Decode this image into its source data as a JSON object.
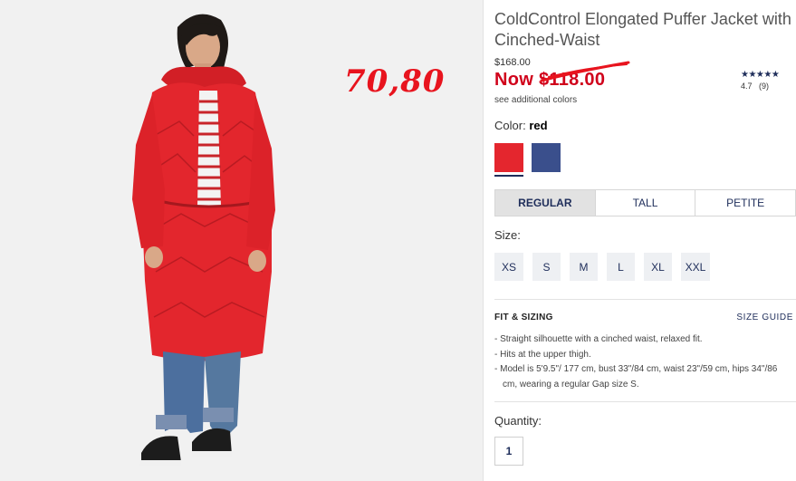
{
  "product": {
    "title": "ColdControl Elongated Puffer Jacket with Cinched-Waist",
    "original_price": "$168.00",
    "now_prefix": "Now ",
    "now_price": "$118.00",
    "see_colors": "see additional colors",
    "rating_value": "4.7",
    "rating_count": "(9)",
    "stars": "★★★★★"
  },
  "annotation": {
    "handwritten_price": "70,80",
    "color": "#e8141e"
  },
  "colors": {
    "label": "Color:",
    "selected": "red",
    "swatches": [
      {
        "name": "red",
        "hex": "#e4262e"
      },
      {
        "name": "navy",
        "hex": "#3a4f8c"
      }
    ]
  },
  "fit_tabs": [
    {
      "label": "REGULAR",
      "active": true
    },
    {
      "label": "TALL",
      "active": false
    },
    {
      "label": "PETITE",
      "active": false
    }
  ],
  "sizes": {
    "label": "Size:",
    "options": [
      "XS",
      "S",
      "M",
      "L",
      "XL",
      "XXL"
    ]
  },
  "fit_sizing": {
    "heading": "FIT & SIZING",
    "size_guide": "SIZE GUIDE",
    "bullets": [
      "- Straight silhouette with a cinched waist, relaxed fit.",
      "- Hits at the upper thigh.",
      "- Model is 5'9.5\"/ 177 cm, bust 33\"/84 cm, waist 23\"/59 cm, hips 34\"/86 cm, wearing a regular Gap size S."
    ]
  },
  "quantity": {
    "label": "Quantity:",
    "value": "1"
  }
}
